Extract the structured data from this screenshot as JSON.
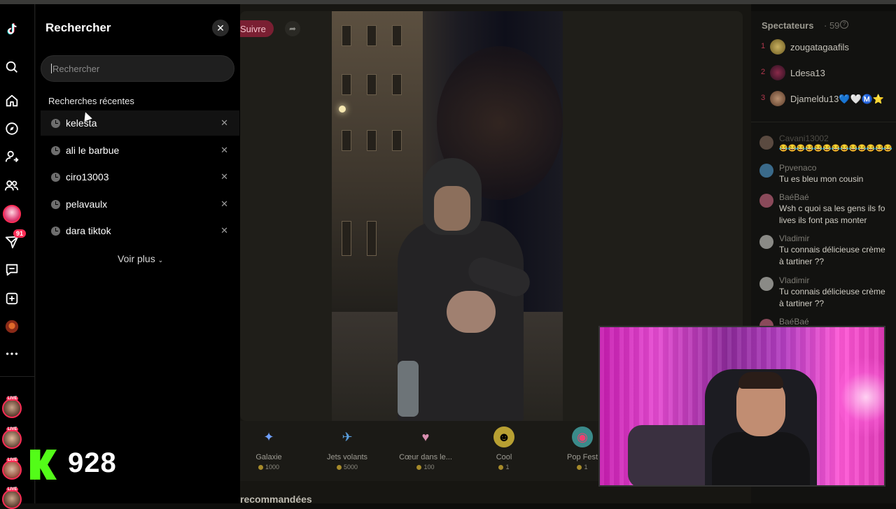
{
  "colors": {
    "accent": "#fe2c55",
    "kick_green": "#53fc18"
  },
  "rail": {
    "messages_badge": "91"
  },
  "search_panel": {
    "title": "Rechercher",
    "search_placeholder": "Rechercher",
    "recent_title": "Recherches récentes",
    "recent_items": [
      {
        "label": "kelesta"
      },
      {
        "label": "ali le barbue"
      },
      {
        "label": "ciro13003"
      },
      {
        "label": "pelavaulx"
      },
      {
        "label": "dara tiktok"
      }
    ],
    "see_more": "Voir plus"
  },
  "stream": {
    "follow_label": "Suivre",
    "gifts": [
      {
        "name": "Galaxie",
        "price": "1000",
        "icon": "galaxy-icon"
      },
      {
        "name": "Jets volants",
        "price": "5000",
        "icon": "jets-icon"
      },
      {
        "name": "Cœur dans le...",
        "price": "100",
        "icon": "heart-hands-icon"
      },
      {
        "name": "Cool",
        "price": "1",
        "icon": "cool-emoji-icon"
      },
      {
        "name": "Pop Fest",
        "price": "1",
        "icon": "pop-fest-icon"
      }
    ],
    "recommended_label": "recommandées"
  },
  "viewers": {
    "title": "Spectateurs",
    "count": "59",
    "top": [
      {
        "rank": "1",
        "name": "zougatagaafils"
      },
      {
        "rank": "2",
        "name": "Ldesa13"
      },
      {
        "rank": "3",
        "name": "Djameldu13💙🤍Ⓜ️⭐"
      }
    ]
  },
  "chat": [
    {
      "name": "Cavani13002",
      "message": "😂😂😂😂😂😂😂😂😂😂😂😂😂"
    },
    {
      "name": "Ppvenaco",
      "message": "Tu es bleu mon cousin"
    },
    {
      "name": "BaéBaé",
      "message": "Wsh c quoi sa les gens ils fo\nlives ils font pas monter"
    },
    {
      "name": "Vladimir",
      "message": "Tu connais délicieuse crème\nà tartiner ??"
    },
    {
      "name": "Vladimir",
      "message": "Tu connais délicieuse crème\nà tartiner ??"
    },
    {
      "name": "BaéBaé",
      "message": ""
    }
  ],
  "overlay": {
    "kick_count": "928"
  }
}
